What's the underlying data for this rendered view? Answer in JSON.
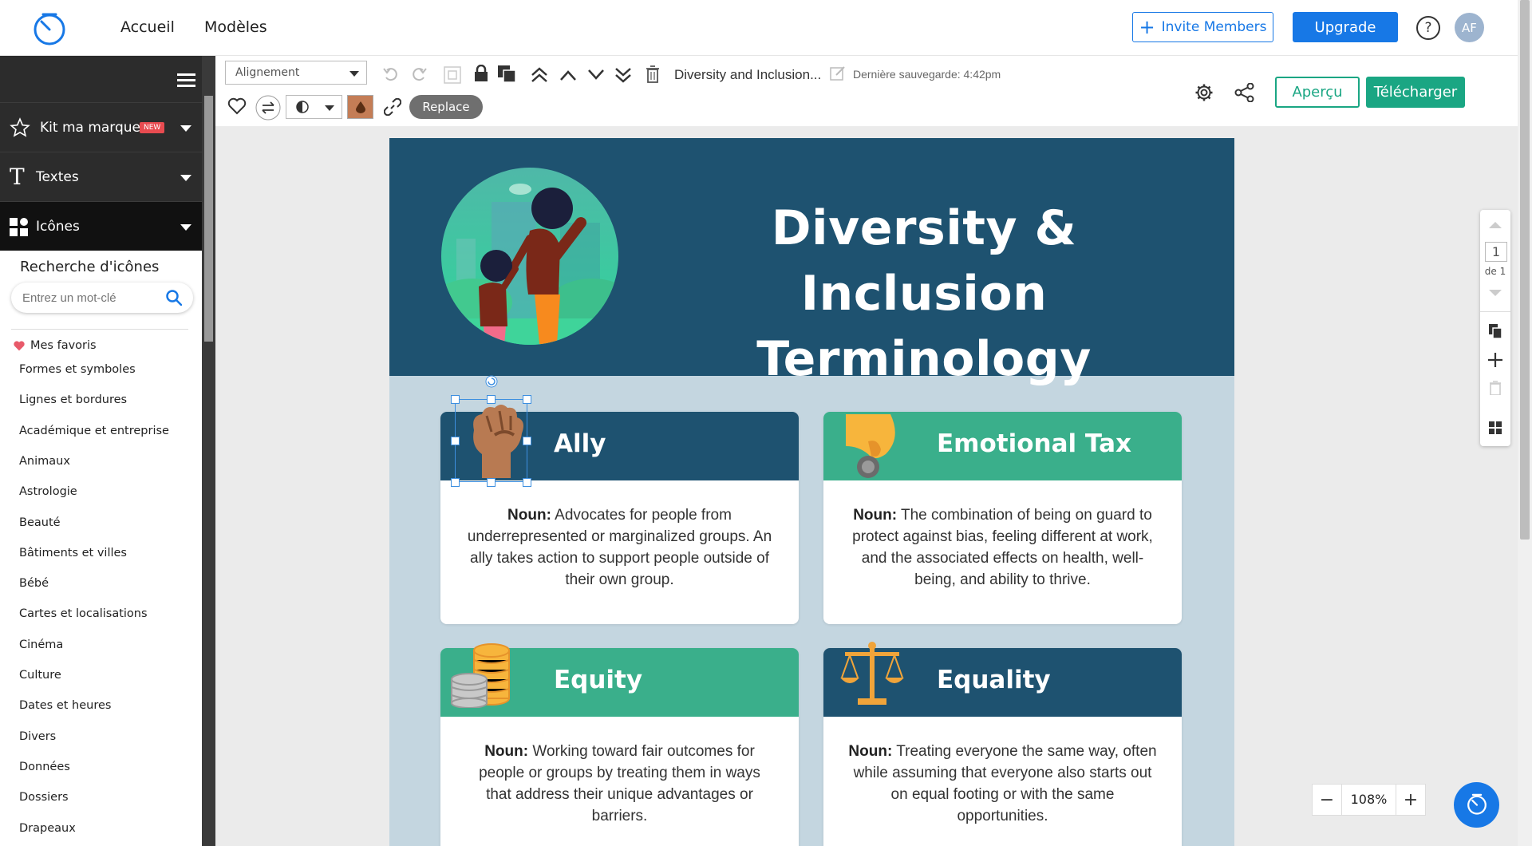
{
  "nav": {
    "links": [
      "Accueil",
      "Modèles"
    ],
    "invite_label": "Invite Members",
    "upgrade_label": "Upgrade",
    "help_label": "?",
    "avatar_initials": "AF"
  },
  "sidebar": {
    "sections": [
      {
        "label": "Kit ma marque",
        "badge": "NEW",
        "icon": "star-icon"
      },
      {
        "label": "Textes",
        "icon": "text-icon"
      },
      {
        "label": "Icônes",
        "icon": "shapes-icon"
      }
    ],
    "search_title": "Recherche d'icônes",
    "search_placeholder": "Entrez un mot-clé",
    "favorites_label": "Mes favoris",
    "categories": [
      "Formes et symboles",
      "Lignes et bordures",
      "Académique et entreprise",
      "Animaux",
      "Astrologie",
      "Beauté",
      "Bâtiments et villes",
      "Bébé",
      "Cartes et localisations",
      "Cinéma",
      "Culture",
      "Dates et heures",
      "Divers",
      "Données",
      "Dossiers",
      "Drapeaux"
    ]
  },
  "toolbar": {
    "alignment_label": "Alignement",
    "doc_title": "Diversity and Inclusion...",
    "last_save": "Dernière sauvegarde: 4:42pm",
    "replace_label": "Replace",
    "apercu_label": "Aperçu",
    "telecharger_label": "Télécharger",
    "selected_color": "#c47d56",
    "accent_color": "#1aa683"
  },
  "canvas": {
    "title": "Diversity & Inclusion Terminology",
    "title_lines": [
      "Diversity & Inclusion",
      "Terminology"
    ],
    "header_bg": "#1e5270",
    "page_bg": "#c4d6e0",
    "cards": [
      {
        "title": "Ally",
        "icon": "raised-fist-icon",
        "header_color": "#1e5270",
        "noun": "Noun:",
        "text": " Advocates for people from underrepresented or marginalized groups. An ally takes action to support people outside of their own group."
      },
      {
        "title": "Emotional Tax",
        "icon": "hand-coin-icon",
        "header_color": "#3aaf8b",
        "noun": "Noun:",
        "text": " The combination of being on guard to protect against bias, feeling different at work, and the associated effects on health, well-being, and ability to thrive."
      },
      {
        "title": "Equity",
        "icon": "coin-stacks-icon",
        "header_color": "#3aaf8b",
        "noun": "Noun:",
        "text": " Working toward fair outcomes for people or groups by treating them in ways that address their unique advantages or barriers."
      },
      {
        "title": "Equality",
        "icon": "scales-icon",
        "header_color": "#1e5270",
        "noun": "Noun:",
        "text": " Treating everyone the same way, often while assuming that everyone also starts out on equal footing or with the same opportunities."
      }
    ]
  },
  "pager": {
    "current": "1",
    "of_label": "de 1"
  },
  "zoom": {
    "value": "108%",
    "minus": "−",
    "plus": "+"
  }
}
